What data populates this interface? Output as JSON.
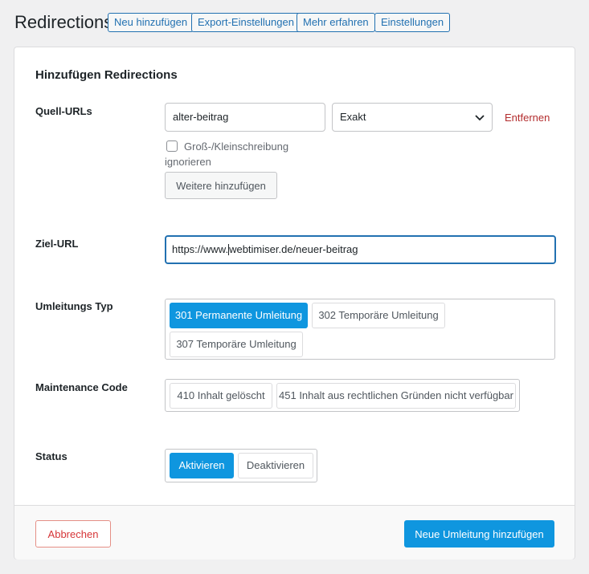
{
  "header": {
    "title": "Redirections",
    "buttons": {
      "add_new": "Neu hinzufügen",
      "export": "Export-Einstellungen",
      "learn_more": "Mehr erfahren",
      "settings": "Einstellungen"
    }
  },
  "form": {
    "title": "Hinzufügen Redirections",
    "source": {
      "label": "Quell-URLs",
      "value": "alter-beitrag",
      "match_type": "Exakt",
      "remove_label": "Entfernen",
      "ignore_case_label": "Groß-/Kleinschreibung ignorieren",
      "ignore_case_checked": false,
      "add_more_label": "Weitere hinzufügen"
    },
    "target": {
      "label": "Ziel-URL",
      "value_before_caret": "https://www.",
      "value_after_caret": "webtimiser.de/neuer-beitrag"
    },
    "redirect_type": {
      "label": "Umleitungs Typ",
      "options": [
        "301 Permanente Umleitung",
        "302 Temporäre Umleitung",
        "307 Temporäre Umleitung"
      ],
      "selected": "301 Permanente Umleitung"
    },
    "maintenance": {
      "label": "Maintenance Code",
      "options": [
        "410 Inhalt gelöscht",
        "451 Inhalt aus rechtlichen Gründen nicht verfügbar"
      ]
    },
    "status": {
      "label": "Status",
      "options": [
        "Aktivieren",
        "Deaktivieren"
      ],
      "selected": "Aktivieren"
    },
    "footer": {
      "cancel_label": "Abbrechen",
      "submit_label": "Neue Umleitung hinzufügen"
    }
  },
  "colors": {
    "accent": "#0f96df",
    "link": "#2271b1",
    "danger": "#b32d2e"
  }
}
